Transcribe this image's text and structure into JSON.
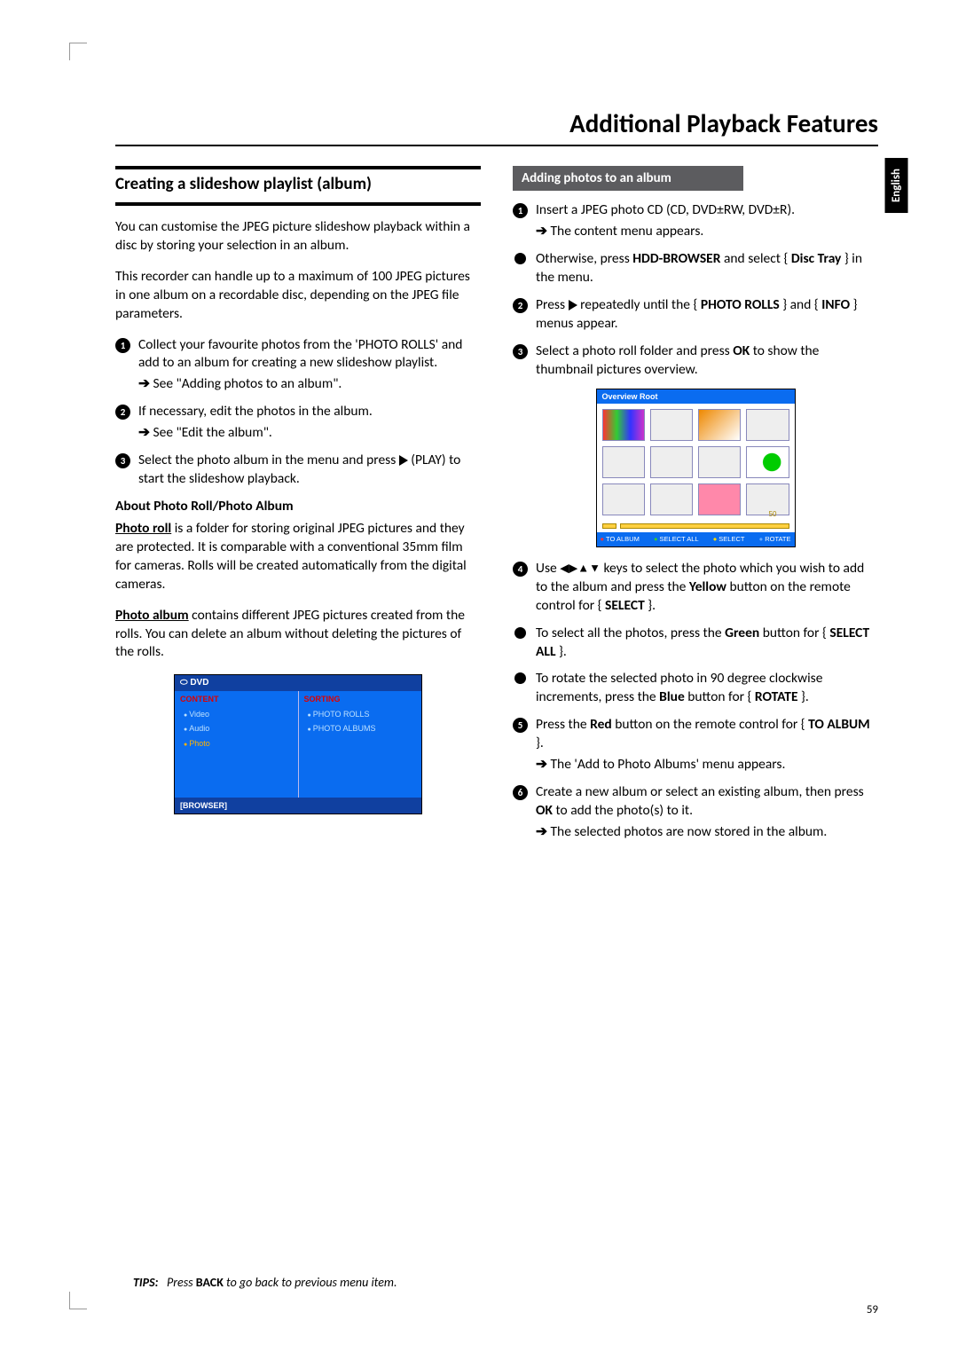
{
  "page_title": "Additional Playback Features",
  "lang_tab": "English",
  "page_number": "59",
  "tips": {
    "label": "TIPS:",
    "text_a": "Press ",
    "bold": "BACK",
    "text_b": " to go back to previous menu item."
  },
  "left": {
    "heading": "Creating a slideshow playlist (album)",
    "intro1": "You can customise the JPEG picture slideshow playback within a disc by storing your selection in an album.",
    "intro2": "This recorder can handle up to a maximum of 100 JPEG pictures in one album on a recordable disc, depending on the JPEG file parameters.",
    "steps": [
      {
        "n": "1",
        "body": "Collect your favourite photos from the 'PHOTO ROLLS' and add to an album for creating a new slideshow playlist.",
        "sub": "See \"Adding photos to an album\"."
      },
      {
        "n": "2",
        "body": "If necessary, edit the photos in the album.",
        "sub": "See \"Edit the album\"."
      },
      {
        "n": "3",
        "body_a": "Select the photo album in the menu and press ",
        "body_b": " (PLAY) to start the slideshow playback."
      }
    ],
    "about_head": "About Photo Roll/Photo Album",
    "about_roll_label": "Photo roll",
    "about_roll": " is a folder for storing original JPEG pictures and they are protected. It is comparable with a conventional 35mm film for cameras. Rolls will be created automatically from the digital cameras.",
    "about_album_label": "Photo album",
    "about_album": " contains different JPEG pictures created from the rolls. You can delete an album without deleting the pictures of the rolls.",
    "browser": {
      "top": "DVD",
      "col1_h": "CONTENT",
      "col1": [
        "Video",
        "Audio",
        "Photo"
      ],
      "col2_h": "SORTING",
      "col2": [
        "PHOTO ROLLS",
        "PHOTO ALBUMS"
      ],
      "bot": "[BROWSER]"
    }
  },
  "right": {
    "heading": "Adding photos to an album",
    "s1_a": "Insert a JPEG photo CD (CD, DVD±RW, DVD±R).",
    "s1_sub": "The content menu appears.",
    "s1b_a": "Otherwise, press ",
    "s1b_b": "HDD-BROWSER",
    "s1b_c": " and select { ",
    "s1b_d": "Disc Tray",
    "s1b_e": " } in the menu.",
    "s2_a": "Press ",
    "s2_b": " repeatedly until the { ",
    "s2_c": "PHOTO ROLLS",
    "s2_d": " } and { ",
    "s2_e": "INFO",
    "s2_f": " } menus appear.",
    "s3_a": "Select a photo roll folder and press ",
    "s3_b": "OK",
    "s3_c": " to show the thumbnail pictures overview.",
    "overview": {
      "head": "Overview Root",
      "count": "50",
      "foot": {
        "r": "TO ALBUM",
        "g": "SELECT ALL",
        "y": "SELECT",
        "b": "ROTATE"
      }
    },
    "s4_a": "Use ",
    "s4_b": " keys to select the photo which you wish to add to the album and press the ",
    "s4_c": "Yellow",
    "s4_d": " button on the remote control for { ",
    "s4_e": "SELECT",
    "s4_f": " }.",
    "s4b_a": "To select all the photos, press the ",
    "s4b_b": "Green",
    "s4b_c": " button for { ",
    "s4b_d": "SELECT ALL",
    "s4b_e": " }.",
    "s4c_a": "To rotate the selected photo in 90 degree clockwise increments, press the ",
    "s4c_b": "Blue",
    "s4c_c": " button for { ",
    "s4c_d": "ROTATE",
    "s4c_e": " }.",
    "s5_a": "Press the ",
    "s5_b": "Red",
    "s5_c": " button on the remote control for { ",
    "s5_d": "TO ALBUM",
    "s5_e": " }.",
    "s5_sub": "The 'Add to Photo Albums' menu appears.",
    "s6_a": "Create a new album or select an existing album, then press ",
    "s6_b": "OK",
    "s6_c": " to add the photo(s) to it.",
    "s6_sub": "The selected photos are now stored in the album."
  }
}
